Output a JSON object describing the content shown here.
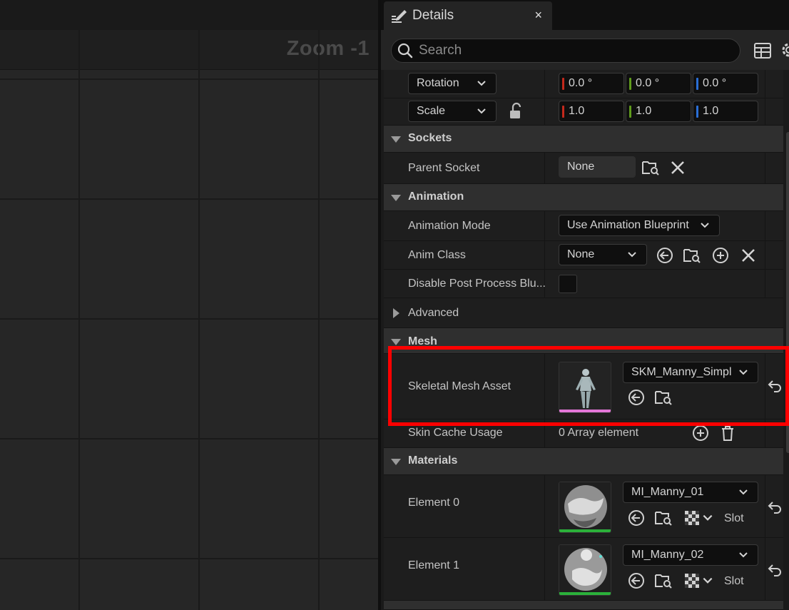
{
  "viewport": {
    "zoom_label": "Zoom -1"
  },
  "panel": {
    "tab_title": "Details",
    "close_glyph": "×",
    "search_placeholder": "Search"
  },
  "transform": {
    "rotation": {
      "mode": "Rotation",
      "x": "0.0 °",
      "y": "0.0 °",
      "z": "0.0 °"
    },
    "scale": {
      "mode": "Scale",
      "x": "1.0",
      "y": "1.0",
      "z": "1.0"
    },
    "axis_colors": {
      "x": "#c4291c",
      "y": "#5f9b1c",
      "z": "#2a6fd6"
    }
  },
  "sockets": {
    "title": "Sockets",
    "parent_socket_label": "Parent Socket",
    "parent_socket_value": "None"
  },
  "animation": {
    "title": "Animation",
    "mode_label": "Animation Mode",
    "mode_value": "Use Animation Blueprint",
    "anim_class_label": "Anim Class",
    "anim_class_value": "None",
    "disable_pp_label": "Disable Post Process Blu...",
    "advanced_label": "Advanced"
  },
  "mesh": {
    "title": "Mesh",
    "skeletal_label": "Skeletal Mesh Asset",
    "skeletal_value": "SKM_Manny_Simpl",
    "skin_cache_label": "Skin Cache Usage",
    "skin_cache_value": "0 Array element",
    "asset_bar_color": "#e377d8"
  },
  "materials": {
    "title": "Materials",
    "slot_label": "Slot",
    "asset_bar_color": "#2bb13a",
    "elements": [
      {
        "label": "Element 0",
        "value": "MI_Manny_01"
      },
      {
        "label": "Element 1",
        "value": "MI_Manny_02"
      }
    ]
  }
}
